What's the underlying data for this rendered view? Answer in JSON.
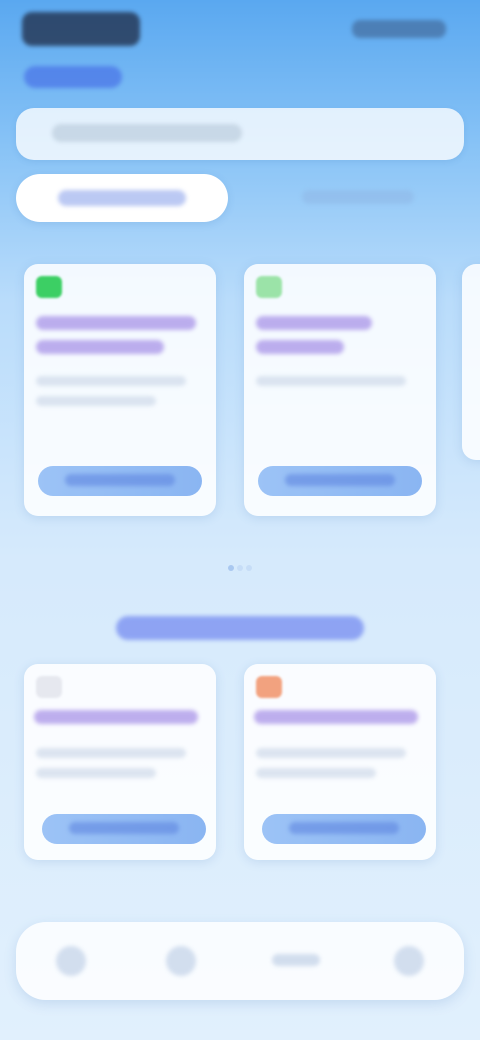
{
  "app": {
    "brand_label": "",
    "subtitle_label": ""
  },
  "search": {
    "placeholder": ""
  },
  "segments": {
    "active_label": "",
    "inactive_label": ""
  },
  "top_cards": [
    {
      "title": "",
      "cta_label": "",
      "chip_color": "#3ccf64"
    },
    {
      "title": "",
      "cta_label": "",
      "chip_color": "#9be3a8"
    }
  ],
  "section": {
    "title": ""
  },
  "bottom_cards": [
    {
      "title": "",
      "cta_label": "",
      "chip_color": "#e6e8ef"
    },
    {
      "title": "",
      "cta_label": "",
      "chip_color": "#f2a27f"
    }
  ],
  "bottom_nav": {
    "items": [
      {
        "icon": "home-icon",
        "label": ""
      },
      {
        "icon": "grid-icon",
        "label": ""
      },
      {
        "icon": "center-label",
        "label": ""
      },
      {
        "icon": "user-icon",
        "label": ""
      }
    ]
  },
  "colors": {
    "accent": "#5a86e6",
    "brand": "#1e2a44"
  }
}
